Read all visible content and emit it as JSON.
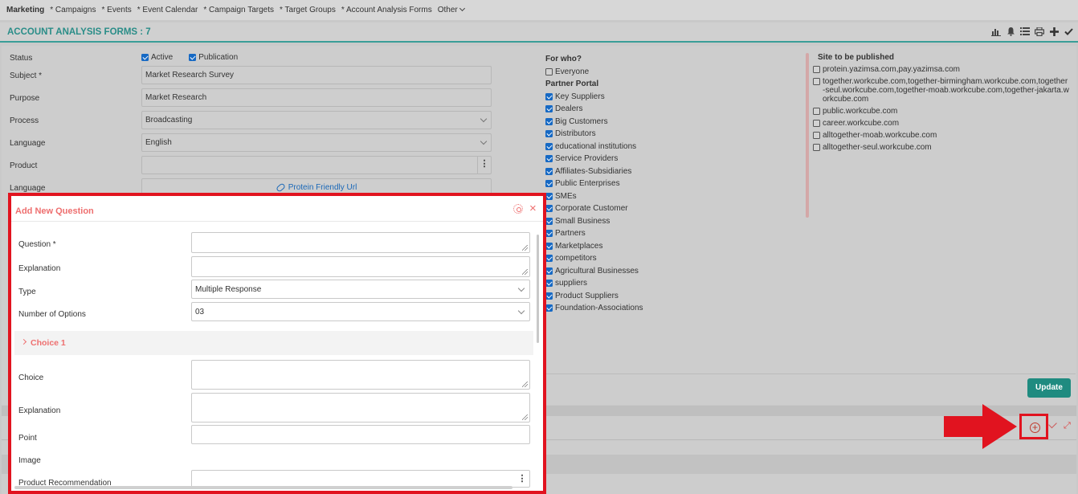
{
  "nav": {
    "brand": "Marketing",
    "items": [
      "* Campaigns",
      "* Events",
      "* Event Calendar",
      "* Campaign Targets",
      "* Target Groups",
      "* Account Analysis Forms"
    ],
    "other": "Other"
  },
  "header": {
    "title": "ACCOUNT ANALYSIS FORMS : 7",
    "icons": [
      "chart-icon",
      "bell-icon",
      "list-icon",
      "print-icon",
      "plus-icon",
      "check-icon"
    ]
  },
  "form": {
    "status_label": "Status",
    "active_label": "Active",
    "publication_label": "Publication",
    "subject_label": "Subject *",
    "subject_value": "Market Research Survey",
    "purpose_label": "Purpose",
    "purpose_value": "Market Research",
    "process_label": "Process",
    "process_value": "Broadcasting",
    "language_label": "Language",
    "language_value": "English",
    "product_label": "Product",
    "product_value": "",
    "language2_label": "Language",
    "friendly_url": "Protein Friendly Url"
  },
  "for_who": {
    "title": "For who?",
    "everyone": "Everyone",
    "portal_title": "Partner Portal",
    "items": [
      "Key Suppliers",
      "Dealers",
      "Big Customers",
      "Distributors",
      "educational institutions",
      "Service Providers",
      "Affiliates-Subsidiaries",
      "Public Enterprises",
      "SMEs",
      "Corporate Customer",
      "Small Business",
      "Partners",
      "Marketplaces",
      "competitors",
      "Agricultural Businesses",
      "suppliers",
      "Product Suppliers",
      "Foundation-Associations"
    ]
  },
  "sites": {
    "title": "Site to be published",
    "items": [
      "protein.yazimsa.com,pay.yazimsa.com",
      "together.workcube.com,together-birmingham.workcube.com,together-seul.workcube.com,together-moab.workcube.com,together-jakarta.workcube.com",
      "public.workcube.com",
      "career.workcube.com",
      "alltogether-moab.workcube.com",
      "alltogether-seul.workcube.com"
    ]
  },
  "update_label": "Update",
  "modal": {
    "title": "Add New Question",
    "question_label": "Question *",
    "explanation_label": "Explanation",
    "type_label": "Type",
    "type_value": "Multiple Response",
    "num_options_label": "Number of Options",
    "num_options_value": "03",
    "choice_title": "Choice 1",
    "choice_label": "Choice",
    "choice_explanation_label": "Explanation",
    "point_label": "Point",
    "image_label": "Image",
    "product_rec_label": "Product Recommendation"
  },
  "colors": {
    "accent": "#2a8d88",
    "modal_accent": "#ee6f6f",
    "highlight": "#e1131f",
    "checkbox": "#1669c4",
    "update_button": "#1f8b80"
  }
}
